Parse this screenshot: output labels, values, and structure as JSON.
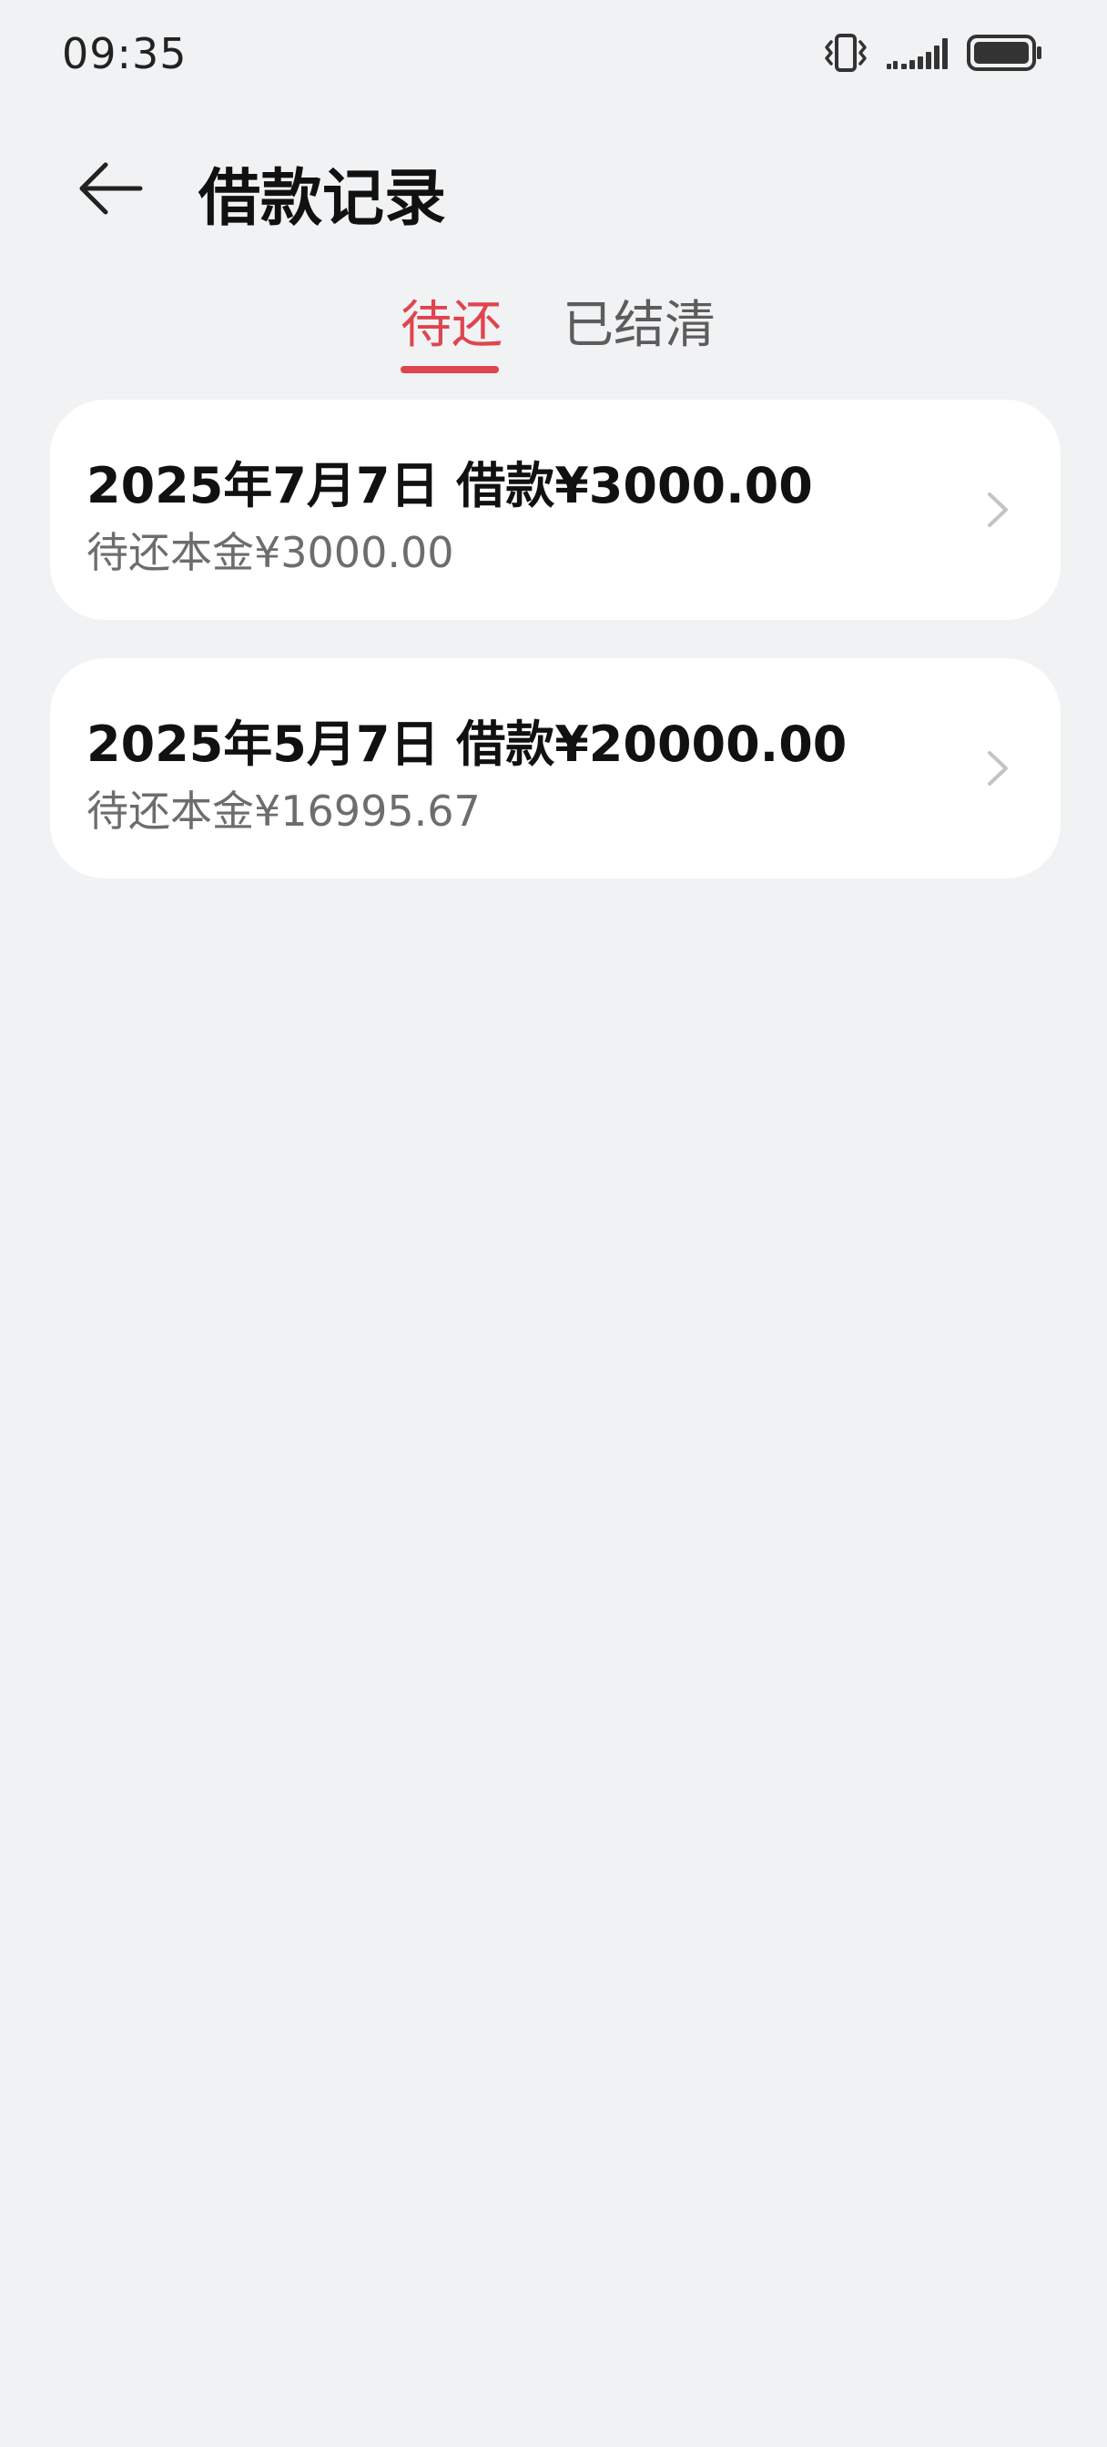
{
  "status_bar": {
    "time": "09:35",
    "icons": [
      "vibrate-icon",
      "signal-icon",
      "battery-icon"
    ]
  },
  "header": {
    "title": "借款记录",
    "back_icon": "arrow-left-icon"
  },
  "tabs": [
    {
      "label": "待还",
      "active": true
    },
    {
      "label": "已结清",
      "active": false
    }
  ],
  "loans": [
    {
      "title": "2025年7月7日 借款¥3000.00",
      "subtitle": "待还本金¥3000.00"
    },
    {
      "title": "2025年5月7日 借款¥20000.00",
      "subtitle": "待还本金¥16995.67"
    }
  ],
  "colors": {
    "accent": "#e0444e",
    "background": "#f1f2f4",
    "card": "#ffffff"
  }
}
